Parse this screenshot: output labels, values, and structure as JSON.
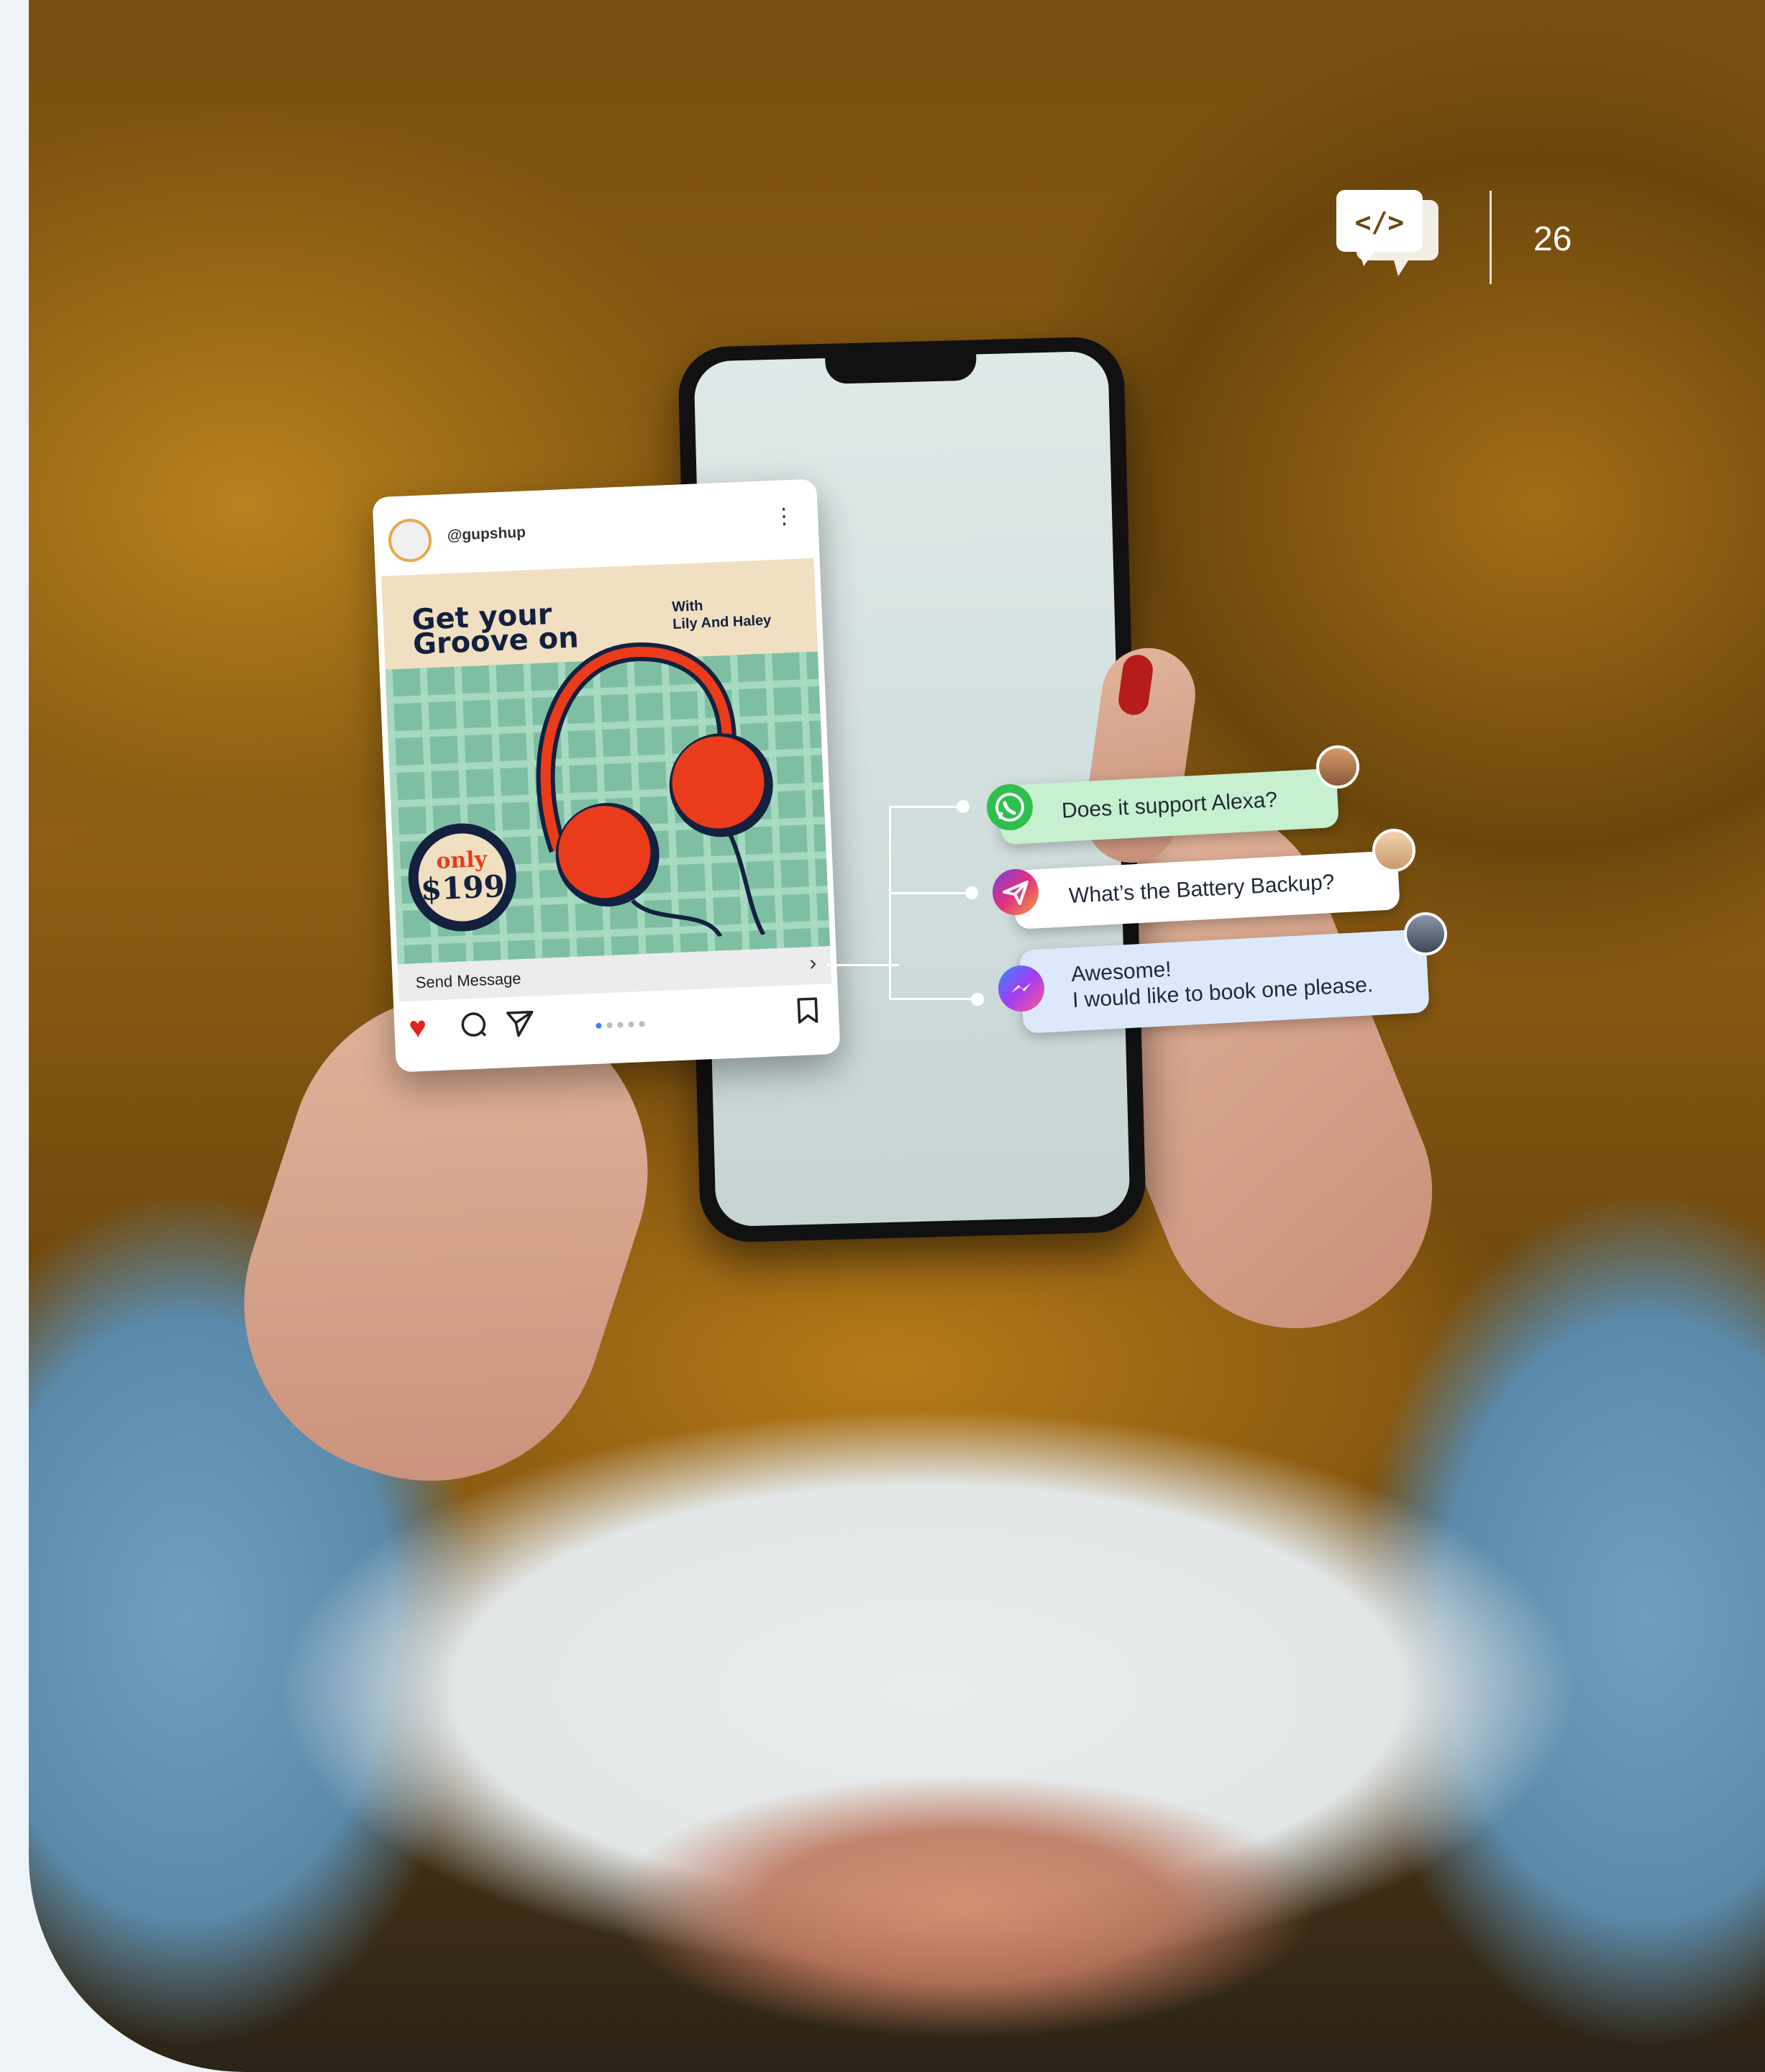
{
  "page": {
    "number": "26"
  },
  "post": {
    "handle": "@gupshup",
    "headline": "Get your\nGroove on",
    "subhead": "With\nLily And Haley",
    "price_tag_top": "only",
    "price_tag_value": "$199",
    "cta_label": "Send Message",
    "carousel_dots": 5,
    "active_dot": 0
  },
  "chat": {
    "messages": [
      {
        "channel": "whatsapp-icon",
        "text": "Does it support Alexa?",
        "color": "#c6f0cf"
      },
      {
        "channel": "instagram-direct-icon",
        "text": "What’s the Battery Backup?",
        "color": "#ffffff"
      },
      {
        "channel": "messenger-icon",
        "text": "Awesome!\nI would like to book one please.",
        "color": "#dbe9fb"
      }
    ]
  },
  "colors": {
    "accent_orange": "#ea3b1a",
    "navy": "#13213f",
    "mint": "#7ebfa3",
    "cream": "#f1dfc1"
  }
}
